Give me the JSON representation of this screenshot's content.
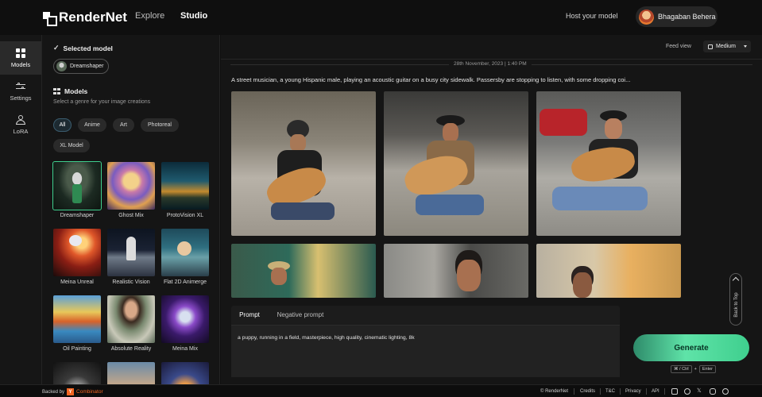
{
  "header": {
    "brand": "RenderNet",
    "nav": [
      "Explore",
      "Studio"
    ],
    "host_link": "Host your model",
    "user_name": "Bhagaban Behera"
  },
  "rail": [
    {
      "label": "Models",
      "icon": "grid-icon",
      "active": true
    },
    {
      "label": "Settings",
      "icon": "sliders-icon",
      "active": false
    },
    {
      "label": "LoRA",
      "icon": "lora-icon",
      "active": false
    }
  ],
  "panel": {
    "selected_title": "Selected model",
    "selected_model": "Dreamshaper",
    "models_title": "Models",
    "models_subtitle": "Select a genre for your image creations",
    "genres": [
      "All",
      "Anime",
      "Art",
      "Photoreal",
      "XL Model"
    ],
    "models": [
      {
        "name": "Dreamshaper",
        "selected": true
      },
      {
        "name": "Ghost Mix"
      },
      {
        "name": "ProtoVision XL"
      },
      {
        "name": "Meina Unreal"
      },
      {
        "name": "Realistic Vision"
      },
      {
        "name": "Flat 2D Animerge"
      },
      {
        "name": "Oil Painting"
      },
      {
        "name": "Absolute Reality"
      },
      {
        "name": "Meina Mix"
      }
    ]
  },
  "feed": {
    "view_label": "Feed view",
    "view_value": "Medium",
    "date": "28th November, 2023 | 1:40 PM",
    "prompt": "A street musician, a young Hispanic male, playing an acoustic guitar on a busy city sidewalk. Passersby are stopping to listen, with some dropping coi...",
    "back_to_top": "Back to Top"
  },
  "prompt_box": {
    "tabs": [
      "Prompt",
      "Negative prompt"
    ],
    "value": "a puppy, running in a field, masterpiece, high quality, cinematic lighting, 8k"
  },
  "generate": {
    "label": "Generate",
    "shortcut_mod": "⌘ / Ctrl",
    "shortcut_plus": "+",
    "shortcut_key": "Enter"
  },
  "footer": {
    "backed_by": "Backed by",
    "yc_letter": "Y",
    "yc_name": "Combinator",
    "links": [
      "© RenderNet",
      "Credits",
      "T&C",
      "Privacy",
      "API"
    ]
  },
  "colors": {
    "accent": "#3fcf8e",
    "background": "#151515"
  }
}
